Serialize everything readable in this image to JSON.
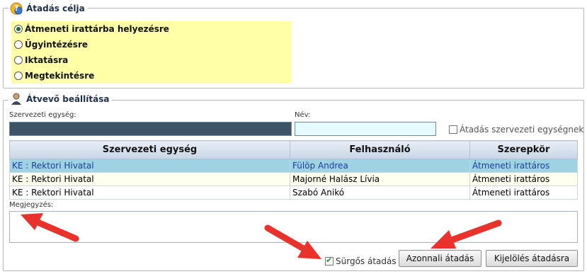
{
  "purpose_section": {
    "title": "Átadás célja",
    "options": [
      {
        "label": "Átmeneti irattárba helyezésre",
        "checked": true
      },
      {
        "label": "Ügyintézésre",
        "checked": false
      },
      {
        "label": "Iktatásra",
        "checked": false
      },
      {
        "label": "Megtekintésre",
        "checked": false
      }
    ]
  },
  "recipient_section": {
    "title": "Átvevő beállítása",
    "org_unit_label": "Szervezeti egység:",
    "name_label": "Név:",
    "org_unit_checkbox_label": "Átadás szervezeti egységnek",
    "table": {
      "columns": [
        "Szervezeti egység",
        "Felhasználó",
        "Szerepkör"
      ],
      "rows": [
        {
          "org": "KE : Rektori Hivatal",
          "user": "Fülöp Andrea",
          "role": "Átmeneti irattáros"
        },
        {
          "org": "KE : Rektori Hivatal",
          "user": "Majorné Halász Lívia",
          "role": "Átmeneti irattáros"
        },
        {
          "org": "KE : Rektori Hivatal",
          "user": "Szabó Anikó",
          "role": "Átmeneti irattáros"
        }
      ]
    },
    "note_label": "Megjegyzés:",
    "urgent_label": "Sürgős átadás",
    "immediate_button": "Azonnali átadás",
    "mark_button": "Kijelölés átadásra"
  },
  "colors": {
    "selected_row": "#9fd3e3",
    "radio_panel": "#ffffa8",
    "annotation_arrow": "#e8322b"
  },
  "icons": {
    "purpose": "help-question-icon",
    "recipient": "user-person-icon"
  }
}
